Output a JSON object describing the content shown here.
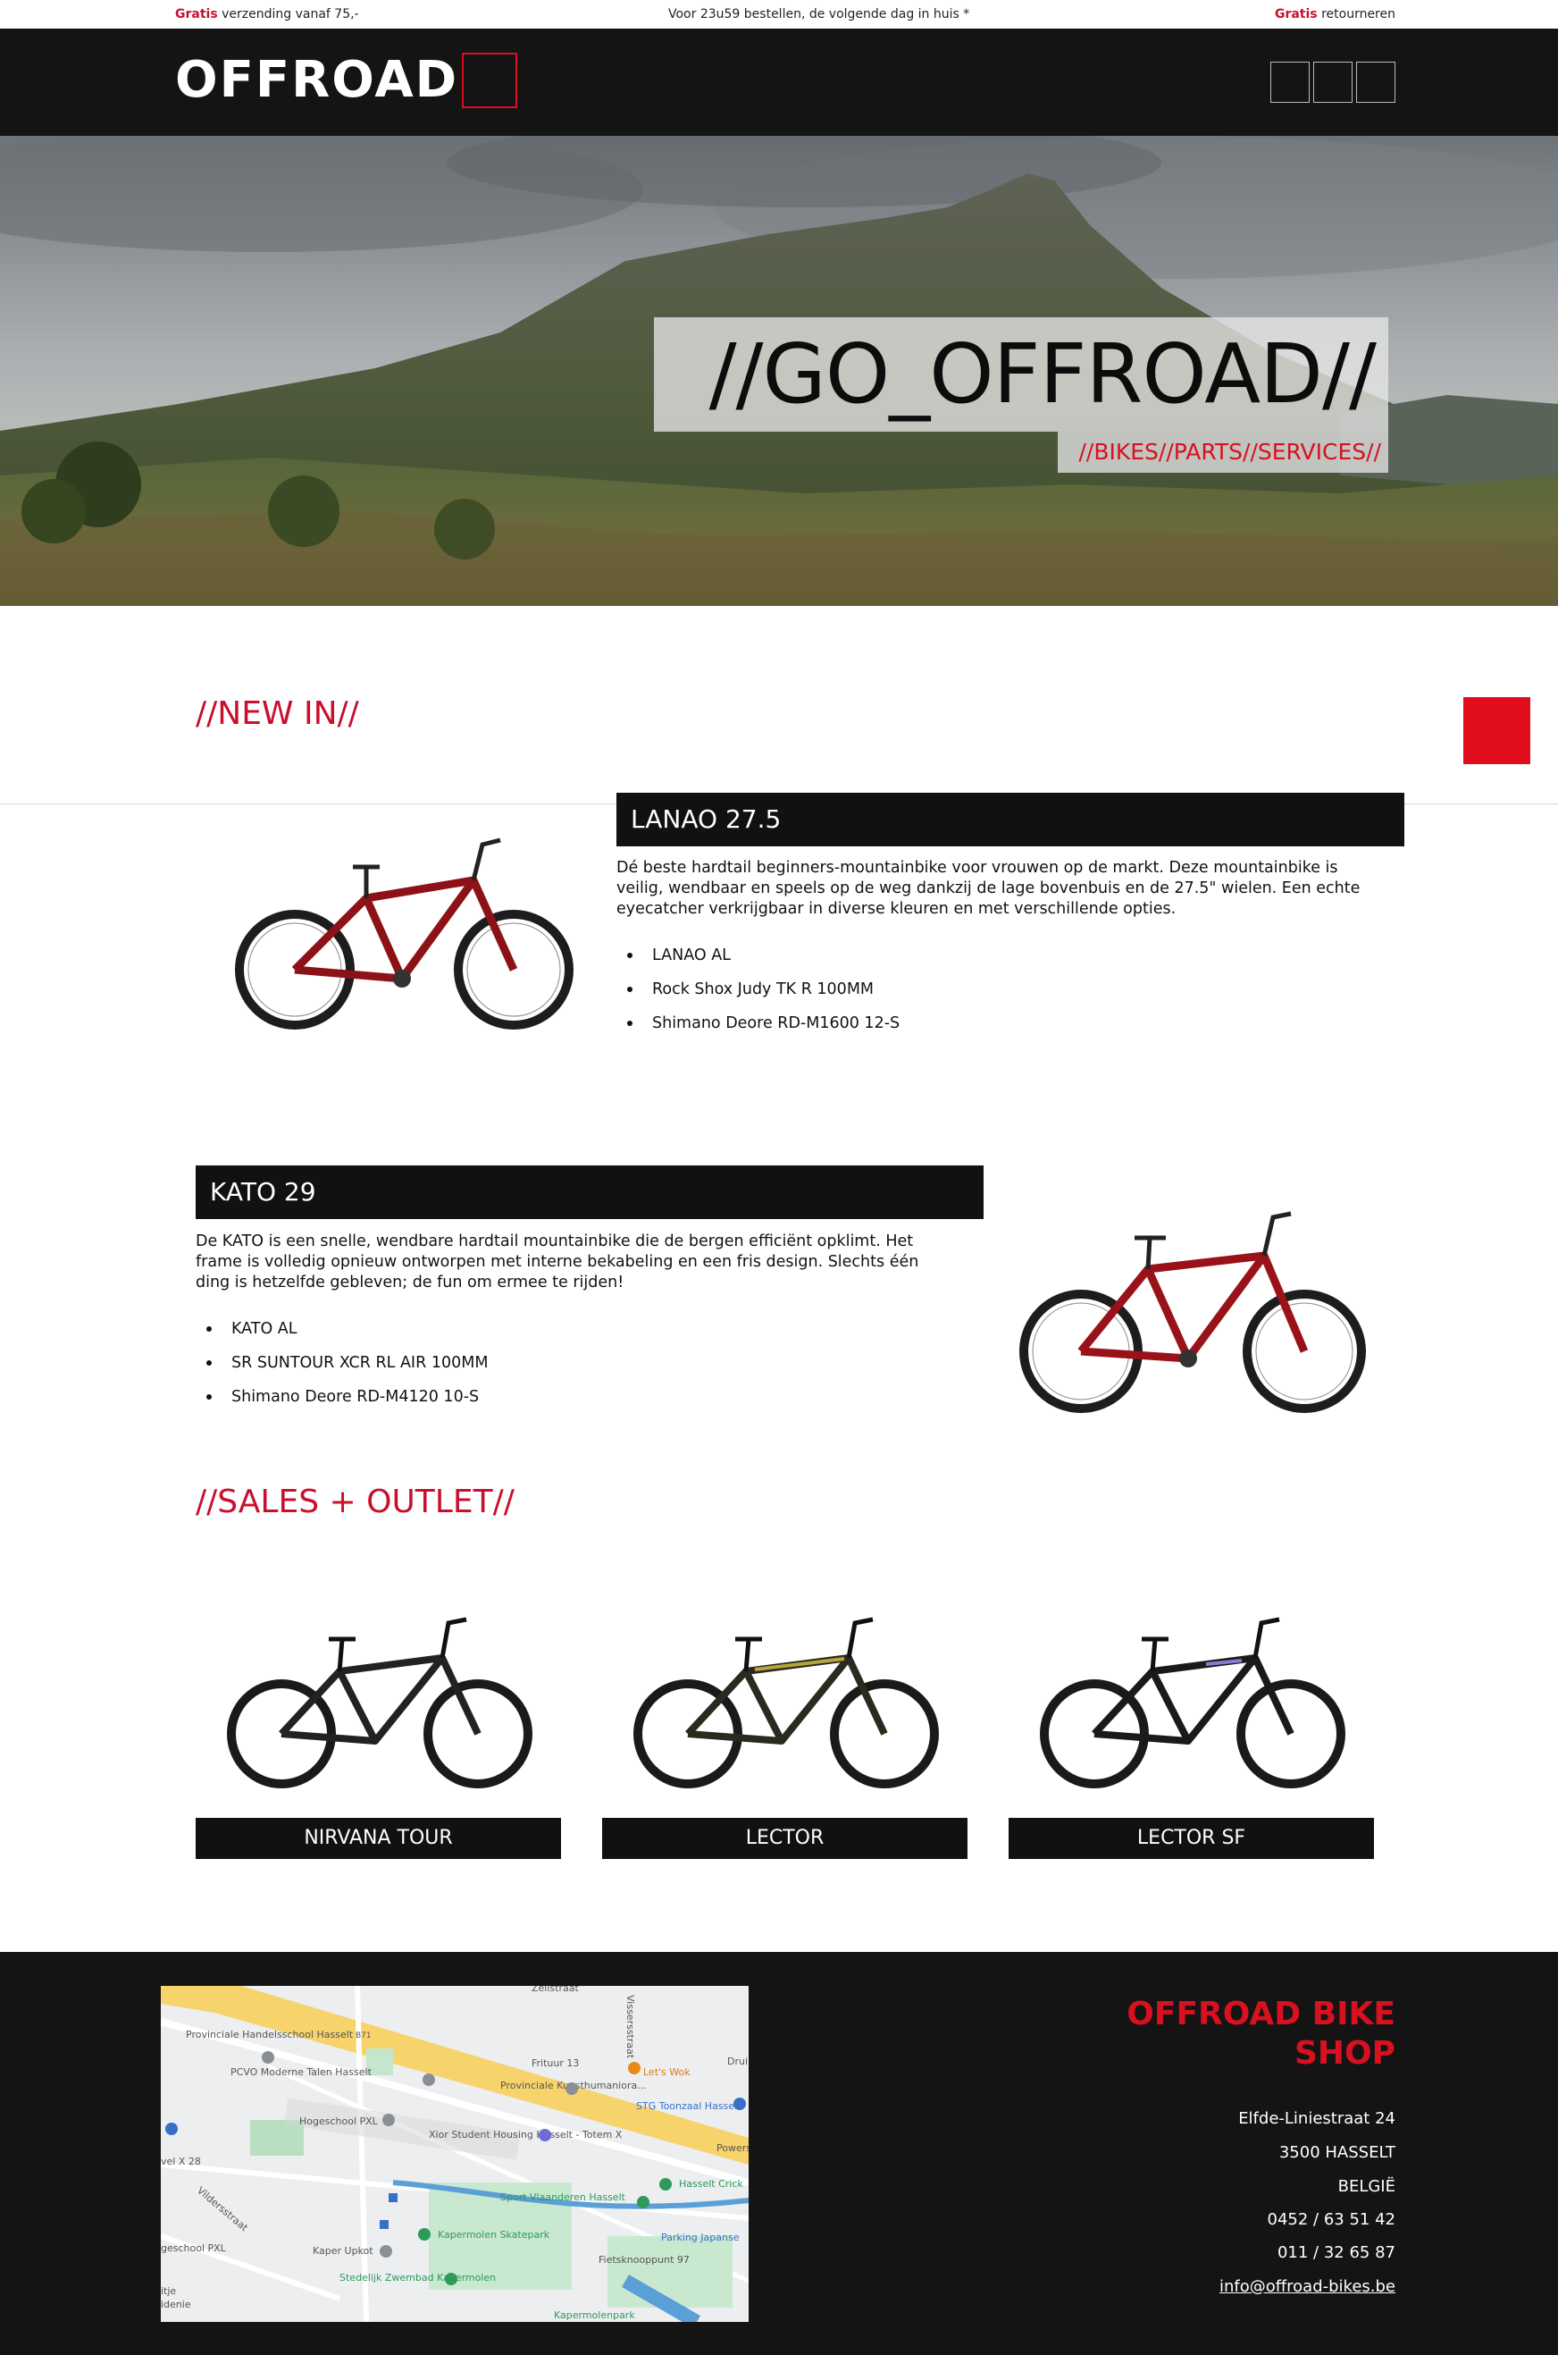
{
  "topbar": {
    "left_accent": "Gratis",
    "left_text": " verzending vanaf 75,-",
    "center_text": "Voor 23u59 bestellen, de volgende dag in huis *",
    "right_accent": "Gratis",
    "right_text": " retourneren"
  },
  "header": {
    "logo_text": "OFFROAD",
    "icons": [
      "account-icon",
      "search-icon",
      "cart-icon"
    ]
  },
  "hero": {
    "title": "//GO_OFFROAD//",
    "subtitle": "//BIKES//PARTS//SERVICES//"
  },
  "new_in": {
    "heading": "//NEW IN//",
    "products": [
      {
        "name": "LANAO 27.5",
        "description": "Dé beste hardtail beginners-mountainbike voor vrouwen op de markt. Deze mountainbike is veilig, wendbaar en speels op de weg dankzij de lage bovenbuis en de 27.5\" wielen. Een echte eyecatcher verkrijgbaar in diverse kleuren en met verschillende opties.",
        "specs": [
          "LANAO AL",
          "Rock Shox Judy TK R 100MM",
          "Shimano Deore RD-M1600 12-S"
        ]
      },
      {
        "name": "KATO 29",
        "description": "De KATO is een snelle, wendbare hardtail mountainbike die de bergen efficiënt opklimt. Het frame is volledig opnieuw ontworpen met interne bekabeling en een fris design. Slechts één ding is hetzelfde gebleven; de fun om ermee te rijden!",
        "specs": [
          "KATO AL",
          "SR SUNTOUR XCR RL AIR 100MM",
          "Shimano Deore RD-M4120 10-S"
        ]
      }
    ]
  },
  "sales": {
    "heading": "//SALES + OUTLET//",
    "items": [
      {
        "label": "NIRVANA TOUR"
      },
      {
        "label": "LECTOR"
      },
      {
        "label": "LECTOR SF"
      }
    ]
  },
  "footer": {
    "shop_name_line1": "OFFROAD BIKE",
    "shop_name_line2": "SHOP",
    "street": "Elfde-Liniestraat 24",
    "city": "3500 HASSELT",
    "country": "BELGIË",
    "phone1": "0452 / 63 51 42",
    "phone2": "011 / 32 65 87",
    "email": "info@offroad-bikes.be",
    "map_labels": {
      "l1": "Zeilstraat",
      "l2": "Provinciale Handelsschool Hasselt",
      "l3": "PCVO Moderne Talen Hasselt",
      "l4": "Frituur 13",
      "l5": "Let's Wok",
      "l6": "Provinciale Kunsthumaniora...",
      "l7": "STG Toonzaal Hasselt",
      "l8": "Hogeschool PXL",
      "l9": "Xior Student Housing Hasselt - Totem X",
      "l10": "Hasselt Crick",
      "l11": "Sport Vlaanderen Hasselt",
      "l12": "Kapermolen Skatepark",
      "l13": "Parking Japanse",
      "l14": "Kaper Upkot",
      "l15": "Fietsknooppunt 97",
      "l16": "Stedelijk Zwembad Kapermolen",
      "l17": "Kapermolenpark",
      "l18": "Vissersstraat",
      "l19": "Vildersstraat",
      "l20": "B71",
      "l21": "vel X 28",
      "l22": "geschool PXL",
      "l23": "Powers",
      "l24": "Drui",
      "l25": "itje",
      "l26": "idenie"
    }
  },
  "colors": {
    "accent_red": "#c8102e",
    "header_black": "#141414",
    "label_black": "#111111"
  }
}
